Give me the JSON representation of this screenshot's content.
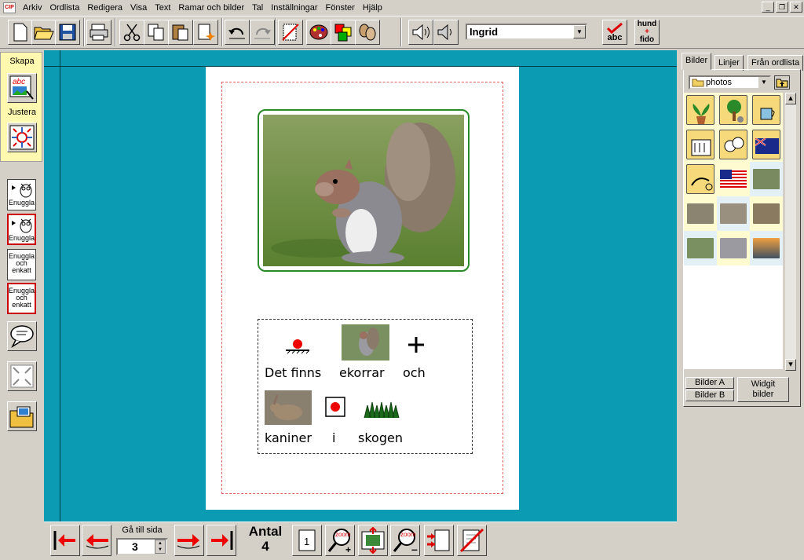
{
  "menu": [
    "Arkiv",
    "Ordlista",
    "Redigera",
    "Visa",
    "Text",
    "Ramar och bilder",
    "Tal",
    "Inställningar",
    "Fönster",
    "Hjälp"
  ],
  "app_icon_text": "CIP",
  "window_controls": {
    "minimize": "_",
    "restore": "❐",
    "close": "✕"
  },
  "voice_selector": "Ingrid",
  "left_panel": {
    "skapa_label": "Skapa",
    "justera_label": "Justera",
    "enuggla_buttons": [
      {
        "text": "Enuggla"
      },
      {
        "text": "Enuggla"
      },
      {
        "text": "Enuggla och enkatt"
      },
      {
        "text": "Enuggla och enkatt"
      }
    ]
  },
  "document": {
    "words_row1": [
      "Det finns",
      "ekorrar",
      "och"
    ],
    "words_row2": [
      "kaniner",
      "i",
      "skogen"
    ]
  },
  "right_panel": {
    "tabs": [
      "Bilder",
      "Linjer",
      "Från ordlista"
    ],
    "folder": "photos",
    "buttons": {
      "bilder_a": "Bilder A",
      "bilder_b": "Bilder B",
      "widgit": "Widgit bilder"
    }
  },
  "bottom_bar": {
    "goto_label": "Gå till sida",
    "goto_value": "3",
    "antal_label": "Antal",
    "antal_value": "4",
    "page_icon_number": "1"
  },
  "toolbar_text": {
    "abc": "abc",
    "hund": "hund",
    "fido": "fido"
  }
}
